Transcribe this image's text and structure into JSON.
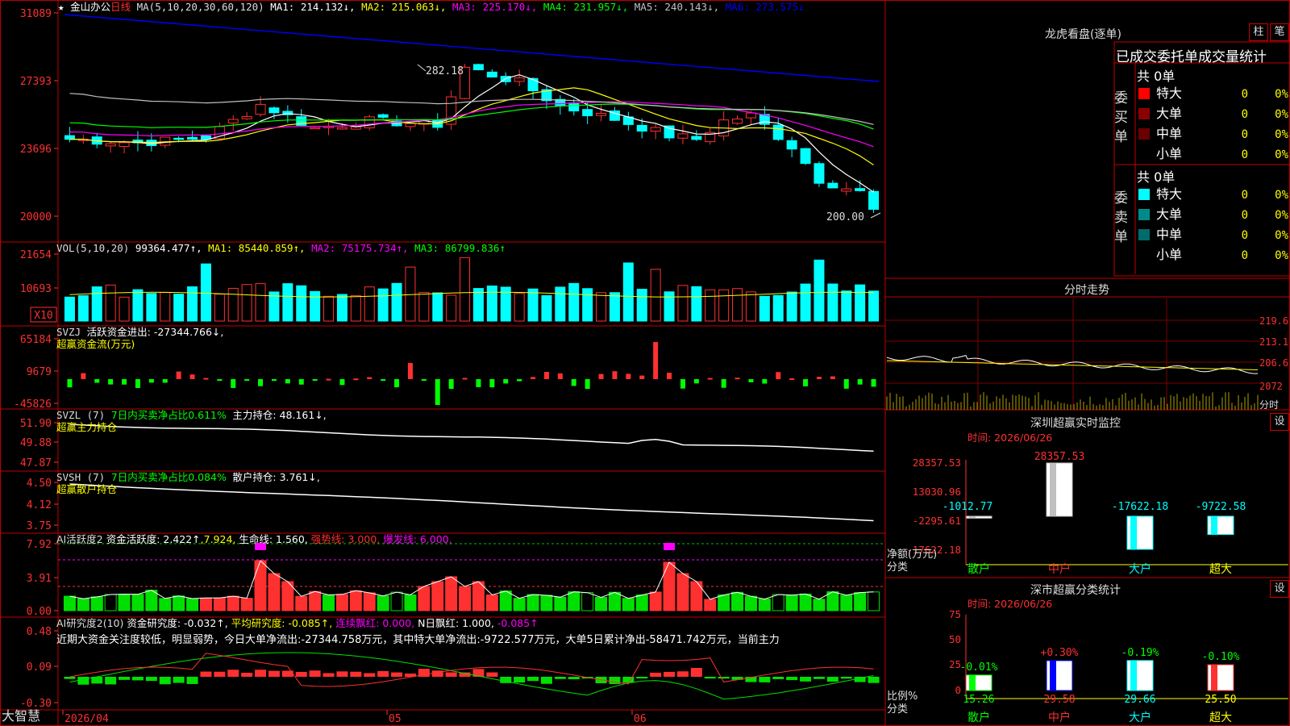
{
  "stock": {
    "name": "金山办公",
    "period": "日线"
  },
  "app_name": "大智慧",
  "colors": {
    "up": "#ff3030",
    "down": "#00ffff",
    "ma1": "#ffffff",
    "ma2": "#ffff00",
    "ma3": "#ff00ff",
    "ma4": "#00ff00",
    "ma5": "#c0c0c0",
    "ma6": "#0000ff"
  },
  "main": {
    "header": {
      "ma_params": "MA(5,10,20,30,60,120)",
      "ma1": "MA1: 214.132↓,",
      "ma2": "MA2: 215.063↓,",
      "ma3": "MA3: 225.170↓,",
      "ma4": "MA4: 231.957↓,",
      "ma5": "MA5: 240.143↓,",
      "ma6": "MA6: 273.575↓"
    },
    "y_ticks": [
      "31089",
      "27393",
      "23696",
      "20000"
    ],
    "high_label": "282.18",
    "low_label": "200.00"
  },
  "vol": {
    "header": {
      "name": "VOL(5,10,20)",
      "value": "99364.477↑,",
      "ma1": "MA1: 85440.859↑,",
      "ma2": "MA2: 75175.734↑,",
      "ma3": "MA3: 86799.836↑"
    },
    "y_ticks": [
      "21654",
      "10693"
    ],
    "unit": "X10"
  },
  "svzj": {
    "header": {
      "name": "SVZJ",
      "desc": "活跃资金进出: -27344.766↓,",
      "sub": "超赢资金流(万元)"
    },
    "y_ticks": [
      "65184",
      "9679",
      "-45826"
    ]
  },
  "svzl": {
    "header": {
      "name": "SVZL (7)",
      "ratio": "7日内买卖净占比0.611%",
      "hold": "主力持仓: 48.161↓,",
      "sub": "超赢主力持仓"
    },
    "y_ticks": [
      "51.90",
      "49.88",
      "47.87"
    ]
  },
  "svsh": {
    "header": {
      "name": "SVSH (7)",
      "ratio": "7日内买卖净占比0.084%",
      "hold": "散户持仓: 3.761↓,",
      "sub": "超赢散户持仓"
    },
    "y_ticks": [
      "4.50",
      "4.12",
      "3.75"
    ]
  },
  "ai_active": {
    "header": {
      "name": "AI活跃度2",
      "desc": "资金活跃度: 2.422↑",
      "v2": ",7.924,",
      "life": "生命线: 1.560,",
      "strong": "强势线: 3.000,",
      "burst": "爆发线: 6.000,"
    },
    "y_ticks": [
      "7.92",
      "3.91",
      "0.00"
    ]
  },
  "ai_research": {
    "header": {
      "name": "AI研究度2(10)",
      "desc": "资金研究度: -0.032↑,",
      "avg": "平均研究度: -0.085↑,",
      "red": "连续飘红: 0.000,",
      "nred": "N日飘红: 1.000,",
      "tail": "-0.085↑"
    },
    "comment": "近期大资金关注度较低，明显弱势，今日大单净流出:-27344.758万元，其中特大单净流出:-9722.577万元，大单5日累计净出-58471.742万元，当前主力",
    "y_ticks": [
      "0.48",
      "0.09",
      "-0.30"
    ]
  },
  "x_axis": {
    "labels": [
      "2026/04",
      "05",
      "06"
    ]
  },
  "right": {
    "lhb": {
      "title": "龙虎看盘(逐单)",
      "btn1": "柱",
      "btn2": "笔",
      "subtitle": "已成交委托单成交量统计",
      "buy": {
        "title": "委买单",
        "total": "共 0单",
        "rows": [
          {
            "label": "特大",
            "val": "0",
            "pct": "0%"
          },
          {
            "label": "大单",
            "val": "0",
            "pct": "0%"
          },
          {
            "label": "中单",
            "val": "0",
            "pct": "0%"
          },
          {
            "label": "小单",
            "val": "0",
            "pct": "0%"
          }
        ]
      },
      "sell": {
        "title": "委卖单",
        "total": "共 0单",
        "rows": [
          {
            "label": "特大",
            "val": "0",
            "pct": "0%"
          },
          {
            "label": "大单",
            "val": "0",
            "pct": "0%"
          },
          {
            "label": "中单",
            "val": "0",
            "pct": "0%"
          },
          {
            "label": "小单",
            "val": "0",
            "pct": "0%"
          }
        ]
      }
    },
    "intraday": {
      "title": "分时走势",
      "y_ticks": [
        "219.6",
        "213.1",
        "206.6",
        "2072"
      ],
      "unit": "分时"
    },
    "monitor": {
      "title": "深圳超赢实时监控",
      "btn": "设",
      "time": "时间: 2026/06/26",
      "y_ticks": [
        "28357.53",
        "13030.96",
        "-2295.61",
        "-17622.18"
      ],
      "y_label": "净额(万元)",
      "x_label": "分类",
      "cats": [
        "散户",
        "中户",
        "大户",
        "超大"
      ],
      "values": [
        "-1012.77",
        "28357.53",
        "-17622.18",
        "-9722.58"
      ]
    },
    "classify": {
      "title": "深市超赢分类统计",
      "btn": "设",
      "time": "时间: 2026/06/26",
      "y_ticks": [
        "75",
        "50",
        "25",
        "0"
      ],
      "y_label": "比例%",
      "x_label": "分类",
      "cats": [
        "散户",
        "中户",
        "大户",
        "超大"
      ],
      "pcts": [
        "15.26",
        "29.58",
        "29.66",
        "25.50"
      ],
      "deltas": [
        "-0.01%",
        "+0.30%",
        "-0.19%",
        "-0.10%"
      ]
    }
  }
}
